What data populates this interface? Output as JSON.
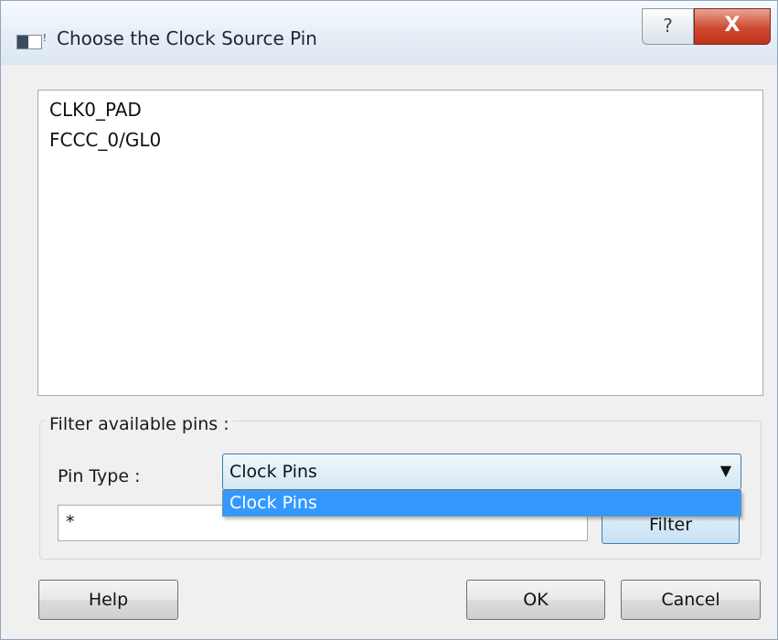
{
  "window": {
    "title": "Choose the Clock Source Pin",
    "help_glyph": "?",
    "close_glyph": "X"
  },
  "pin_list": {
    "items": [
      "CLK0_PAD",
      "FCCC_0/GL0"
    ]
  },
  "filter": {
    "group_label": "Filter available pins :",
    "pin_type_label": "Pin Type :",
    "pin_type_value": "Clock Pins",
    "dropdown_options": [
      "Clock Pins"
    ],
    "pattern_value": "*",
    "filter_button_label": "Filter"
  },
  "buttons": {
    "help_label": "Help",
    "ok_label": "OK",
    "cancel_label": "Cancel"
  },
  "icons": {
    "window_icon": "window-icon",
    "combo_arrow": "chevron-down-icon"
  },
  "colors": {
    "selection": "#3399ff",
    "close_button": "#c0311b",
    "focus_border": "#3c7fb1"
  }
}
